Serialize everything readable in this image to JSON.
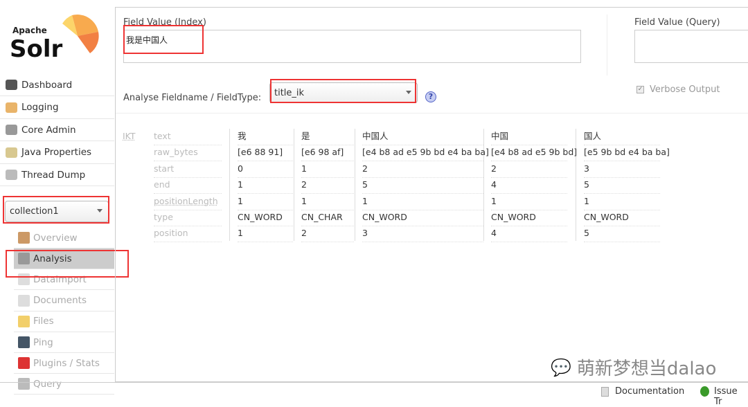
{
  "logo": {
    "text_small": "Apache",
    "text_big": "Solr"
  },
  "sidebar": {
    "items": [
      {
        "label": "Dashboard",
        "icon": "dashboard-icon"
      },
      {
        "label": "Logging",
        "icon": "logging-icon"
      },
      {
        "label": "Core Admin",
        "icon": "core-admin-icon"
      },
      {
        "label": "Java Properties",
        "icon": "java-properties-icon"
      },
      {
        "label": "Thread Dump",
        "icon": "thread-dump-icon"
      }
    ],
    "core_selector": "collection1",
    "core_items": [
      {
        "label": "Overview",
        "icon": "home-icon"
      },
      {
        "label": "Analysis",
        "icon": "funnel-icon",
        "active": true
      },
      {
        "label": "Dataimport",
        "icon": "dataimport-icon"
      },
      {
        "label": "Documents",
        "icon": "documents-icon"
      },
      {
        "label": "Files",
        "icon": "folder-icon"
      },
      {
        "label": "Ping",
        "icon": "ping-icon"
      },
      {
        "label": "Plugins / Stats",
        "icon": "plugins-icon"
      },
      {
        "label": "Query",
        "icon": "magnifier-icon"
      }
    ]
  },
  "form": {
    "index_label": "Field Value (Index)",
    "index_value": "我是中国人",
    "query_label": "Field Value (Query)",
    "query_value": "",
    "fieldtype_label": "Analyse Fieldname / FieldType:",
    "fieldtype_value": "title_ik",
    "verbose_label": "Verbose Output",
    "verbose_checked": true
  },
  "analysis": {
    "analyzer": "IKT",
    "row_labels": [
      "text",
      "raw_bytes",
      "start",
      "end",
      "positionLength",
      "type",
      "position"
    ],
    "tokens": [
      [
        "我",
        "[e6 88 91]",
        "0",
        "1",
        "1",
        "CN_WORD",
        "1"
      ],
      [
        "是",
        "[e6 98 af]",
        "1",
        "2",
        "1",
        "CN_CHAR",
        "2"
      ],
      [
        "中国人",
        "[e4 b8 ad e5 9b bd e4 ba ba]",
        "2",
        "5",
        "1",
        "CN_WORD",
        "3"
      ],
      [
        "中国",
        "[e4 b8 ad e5 9b bd]",
        "2",
        "4",
        "1",
        "CN_WORD",
        "4"
      ],
      [
        "国人",
        "[e5 9b bd e4 ba ba]",
        "3",
        "5",
        "1",
        "CN_WORD",
        "5"
      ]
    ]
  },
  "watermark": "萌新梦想当dalao",
  "footer": {
    "documentation": "Documentation",
    "issue_tracker": "Issue Tr"
  },
  "colors": {
    "highlight_box": "#e33333",
    "active_bg": "#cccccc"
  }
}
